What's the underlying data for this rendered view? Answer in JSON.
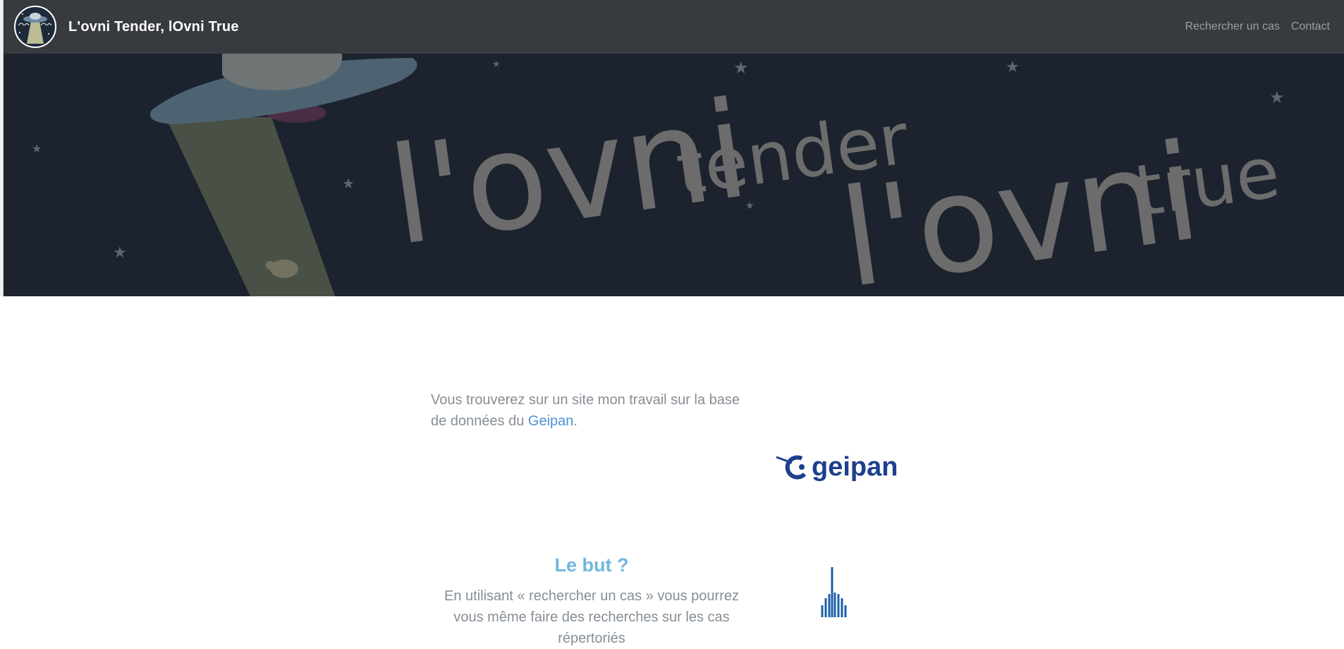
{
  "navbar": {
    "brand_title": "L'ovni Tender, lOvni True",
    "links": [
      {
        "label": "Rechercher un cas"
      },
      {
        "label": "Contact"
      }
    ]
  },
  "hero": {
    "words": [
      "l'ovni",
      "tender",
      "l'ovni",
      "true"
    ]
  },
  "intro": {
    "text_before": "Vous trouverez sur un site mon travail sur la base de données du ",
    "link_text": "Geipan",
    "text_after": "."
  },
  "logos": {
    "geipan_text": "geipan"
  },
  "goal": {
    "heading": "Le but ?",
    "text": "En utilisant « rechercher un cas » vous pourrez vous même faire des recherches sur les cas répertoriés"
  },
  "colors": {
    "navbar_bg": "#373a3f",
    "hero_bg": "#1c232e",
    "accent_heading": "#6fb8dd",
    "link": "#4a90d6",
    "body_text": "#868e96",
    "geipan_blue": "#1d3f8c"
  }
}
